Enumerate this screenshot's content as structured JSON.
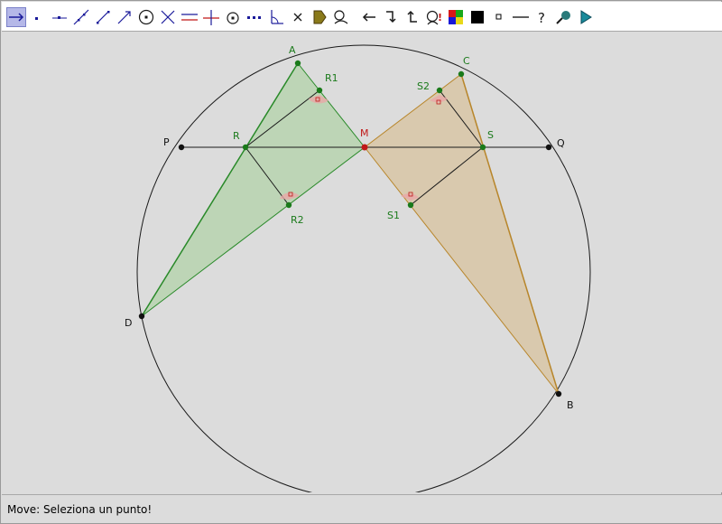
{
  "toolbar": {
    "tools": [
      {
        "name": "move-tool-icon",
        "active": true
      },
      {
        "name": "point-tool-icon"
      },
      {
        "name": "point-on-line-tool-icon"
      },
      {
        "name": "line-tool-icon"
      },
      {
        "name": "segment-tool-icon"
      },
      {
        "name": "vector-tool-icon"
      },
      {
        "name": "circle-tool-icon"
      },
      {
        "name": "intersect-tool-icon"
      },
      {
        "name": "parallel-line-tool-icon"
      },
      {
        "name": "perpendicular-line-tool-icon"
      },
      {
        "name": "midpoint-tool-icon"
      },
      {
        "name": "dotted-line-tool-icon"
      },
      {
        "name": "angle-tool-icon"
      },
      {
        "name": "delete-tool-icon"
      },
      {
        "name": "polygon-tool-icon"
      },
      {
        "name": "locus-tool-icon"
      },
      {
        "name": "back-arrow-tool-icon"
      },
      {
        "name": "redo-tool-icon"
      },
      {
        "name": "undo-tool-icon"
      },
      {
        "name": "check-tool-icon",
        "text": "!"
      },
      {
        "name": "color-palette-icon"
      },
      {
        "name": "fill-square-icon"
      },
      {
        "name": "small-square-icon"
      },
      {
        "name": "line-style-icon"
      },
      {
        "name": "help-icon",
        "text": "?"
      },
      {
        "name": "magnifier-tool-icon"
      },
      {
        "name": "play-icon"
      }
    ]
  },
  "canvas": {
    "points": {
      "A": "A",
      "C": "C",
      "R1": "R1",
      "S2": "S2",
      "P": "P",
      "R": "R",
      "M": "M",
      "S": "S",
      "Q": "Q",
      "R2": "R2",
      "S1": "S1",
      "D": "D",
      "B": "B"
    }
  },
  "colors": {
    "green_fill": "#b9d4b1",
    "green_stroke": "#2a8a2a",
    "tan_fill": "#d9c9ad",
    "tan_stroke": "#b8862b",
    "point_green": "#1a7a1a",
    "point_red": "#c01818",
    "angle_mark": "#e8a8a8"
  },
  "status": {
    "text": "Move: Seleziona un punto!"
  }
}
